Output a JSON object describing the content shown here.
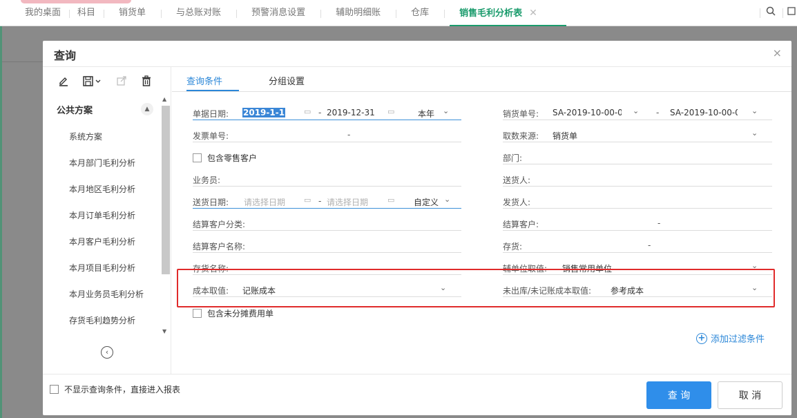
{
  "top_tabs": [
    {
      "label": "我的桌面"
    },
    {
      "label": "科目"
    },
    {
      "label": "销货单"
    },
    {
      "label": "与总账对账"
    },
    {
      "label": "预警消息设置"
    },
    {
      "label": "辅助明细账"
    },
    {
      "label": "仓库"
    },
    {
      "label": "销售毛利分析表",
      "active": true
    }
  ],
  "top_icons": {
    "close": "✕",
    "search": "search-icon"
  },
  "dialog": {
    "title": "查询",
    "close_glyph": "×",
    "toolbar_icons": [
      "edit-icon",
      "save-icon",
      "export-icon",
      "delete-icon"
    ],
    "scheme_group": "公共方案",
    "schemes": [
      "系统方案",
      "本月部门毛利分析",
      "本月地区毛利分析",
      "本月订单毛利分析",
      "本月客户毛利分析",
      "本月项目毛利分析",
      "本月业务员毛利分析",
      "存货毛利趋势分析"
    ],
    "tabs": [
      "查询条件",
      "分组设置"
    ],
    "fields": {
      "doc_date": {
        "label": "单据日期:",
        "from": "2019-1-1",
        "to": "2019-12-31",
        "period": "本年"
      },
      "sales_no": {
        "label": "销货单号:",
        "from": "SA-2019-10-00-0",
        "to": "SA-2019-10-00-0"
      },
      "invoice_no": {
        "label": "发票单号:",
        "dash": "-"
      },
      "data_source": {
        "label": "取数来源:",
        "value": "销货单"
      },
      "include_retail": {
        "label": "包含零售客户"
      },
      "department": {
        "label": "部门:"
      },
      "salesman": {
        "label": "业务员:"
      },
      "deliverer": {
        "label": "送货人:"
      },
      "delivery_date": {
        "label": "送货日期:",
        "placeholder_from": "请选择日期",
        "placeholder_to": "请选择日期",
        "period": "自定义"
      },
      "shipper": {
        "label": "发货人:"
      },
      "settle_cust_class": {
        "label": "结算客户分类:"
      },
      "settle_cust": {
        "label": "结算客户:",
        "dash": "-"
      },
      "settle_cust_name": {
        "label": "结算客户名称:"
      },
      "inventory": {
        "label": "存货:",
        "dash": "-"
      },
      "inventory_name": {
        "label": "存货名称:"
      },
      "aux_unit": {
        "label": "辅单位取值:",
        "value": "销售常用单位"
      },
      "cost_value": {
        "label": "成本取值:",
        "value": "记账成本"
      },
      "unposted_cost": {
        "label": "未出库/未记账成本取值:",
        "value": "参考成本"
      },
      "include_unallocated": {
        "label": "包含未分摊费用单"
      }
    },
    "add_filter": "添加过滤条件",
    "footer": {
      "skip_label": "不显示查询条件，直接进入报表",
      "query_btn": "查 询",
      "cancel_btn": "取 消"
    }
  },
  "colors": {
    "accent": "#2f8eea",
    "active_tab": "#1a9b6c",
    "highlight": "#e02a2a"
  }
}
